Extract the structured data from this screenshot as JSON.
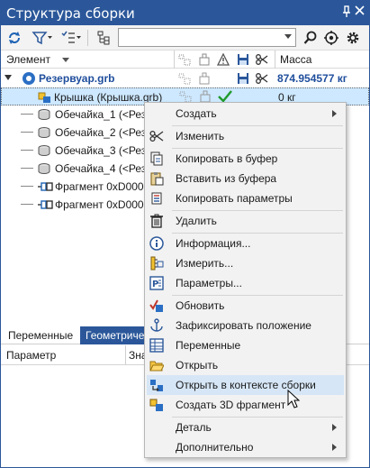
{
  "window": {
    "title": "Структура сборки",
    "pin_glyph": "ᵖ",
    "close_glyph": "✕"
  },
  "toolbar": {
    "buttons": [
      "refresh-icon",
      "filter-icon",
      "list-filter-icon",
      "tree-icon"
    ],
    "search_value": "",
    "right_buttons": [
      "search-icon",
      "locate-icon",
      "settings-icon"
    ]
  },
  "columns": {
    "element": "Элемент",
    "mass": "Масса"
  },
  "tree": {
    "root": {
      "label": "Резервуар.grb",
      "mass": "874.954577 кг"
    },
    "rows": [
      {
        "label": "Крышка (Крышка.grb)",
        "mass": "0 кг",
        "selected": true
      },
      {
        "label": "Обечайка_1 (<Рез"
      },
      {
        "label": "Обечайка_2 (<Рез"
      },
      {
        "label": "Обечайка_3 (<Рез"
      },
      {
        "label": "Обечайка_4 (<Рез"
      },
      {
        "label": "Фрагмент 0xD0000"
      },
      {
        "label": "Фрагмент 0xD0000"
      }
    ]
  },
  "bottom": {
    "tabs": [
      "Переменные",
      "Геометриче"
    ],
    "grid_headers": {
      "param": "Параметр",
      "value": "Зна"
    }
  },
  "menu": {
    "items": [
      {
        "label": "Создать",
        "icon": "",
        "submenu": true
      },
      {
        "label": "Изменить",
        "icon": "scissors-icon"
      },
      {
        "label": "Копировать в буфер",
        "icon": "copy-icon"
      },
      {
        "label": "Вставить из буфера",
        "icon": "paste-icon"
      },
      {
        "label": "Копировать параметры",
        "icon": "copy-params-icon"
      },
      {
        "label": "Удалить",
        "icon": "trash-icon"
      },
      {
        "label": "Информация...",
        "icon": "info-icon"
      },
      {
        "label": "Измерить...",
        "icon": "measure-icon"
      },
      {
        "label": "Параметры...",
        "icon": "params-icon"
      },
      {
        "label": "Обновить",
        "icon": "update-icon"
      },
      {
        "label": "Зафиксировать положение",
        "icon": "anchor-icon"
      },
      {
        "label": "Переменные",
        "icon": "variables-icon"
      },
      {
        "label": "Открыть",
        "icon": "open-folder-icon"
      },
      {
        "label": "Открыть в контексте сборки",
        "icon": "open-in-context-icon",
        "highlighted": true
      },
      {
        "label": "Создать 3D фрагмент",
        "icon": "create-3d-fragment-icon"
      },
      {
        "label": "Деталь",
        "icon": "",
        "submenu": true
      },
      {
        "label": "Дополнительно",
        "icon": "",
        "submenu": true
      }
    ]
  },
  "colors": {
    "accent": "#2b579a",
    "selection": "#cde8ff",
    "menu_highlight": "#d6e6f6",
    "mass_text": "#1f4e9c"
  }
}
